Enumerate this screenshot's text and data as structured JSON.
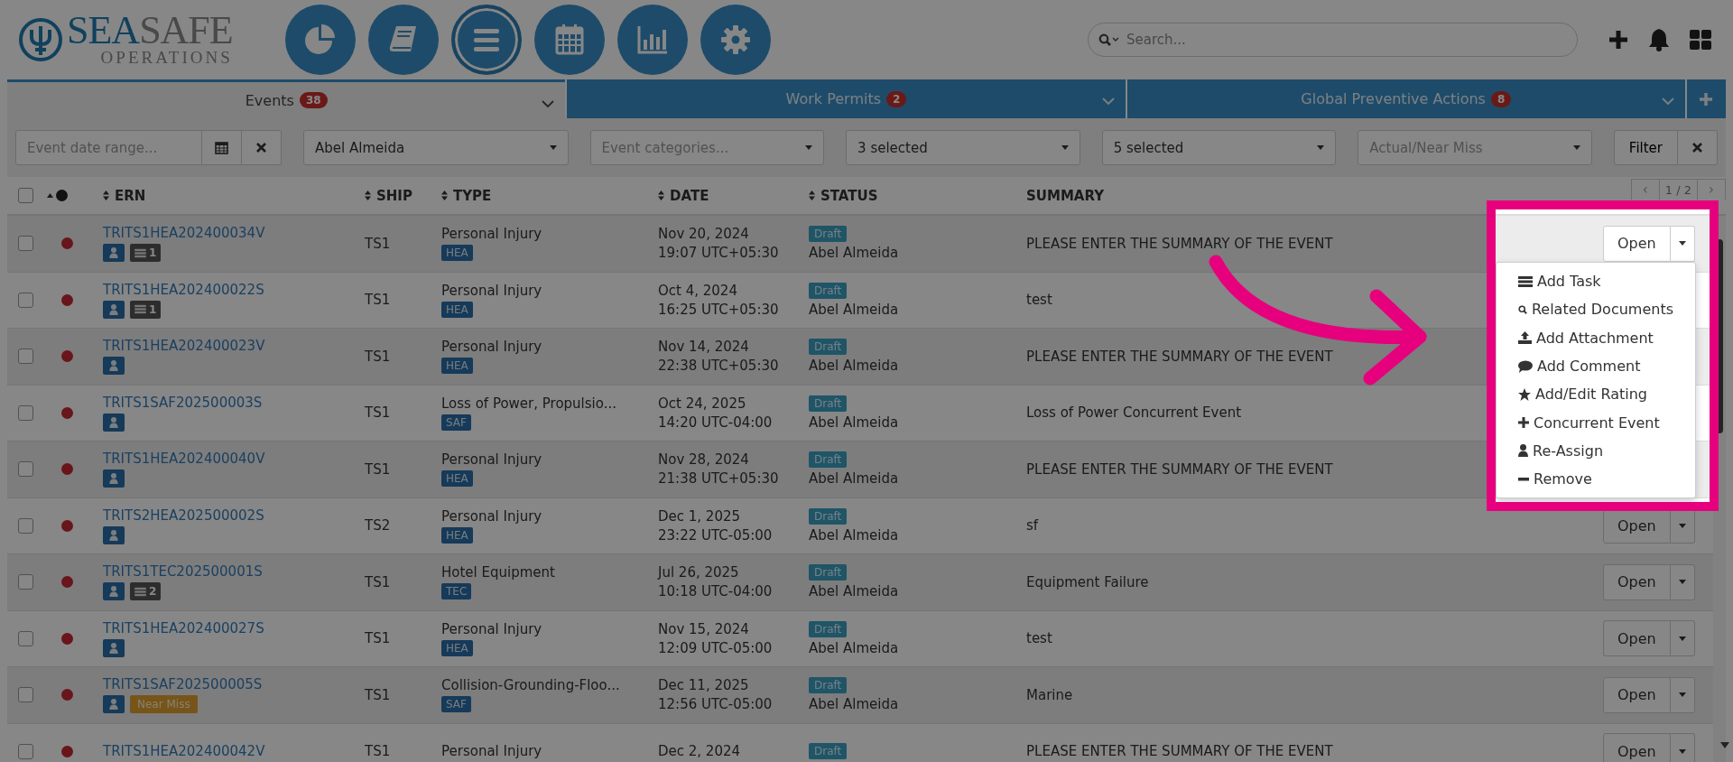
{
  "logo": {
    "primary": "SEA",
    "secondary": "SAFE",
    "tagline": "OPERATIONS"
  },
  "nav_buttons": [
    {
      "kind": "pie",
      "selected": false
    },
    {
      "kind": "book",
      "selected": false
    },
    {
      "kind": "list",
      "selected": true
    },
    {
      "kind": "calendar",
      "selected": false
    },
    {
      "kind": "chart",
      "selected": false
    },
    {
      "kind": "gear",
      "selected": false
    }
  ],
  "search": {
    "placeholder": "Search..."
  },
  "tabs": [
    {
      "label": "Events",
      "count": "38",
      "selected": true
    },
    {
      "label": "Work Permits",
      "count": "2",
      "selected": false
    },
    {
      "label": "Global Preventive Actions",
      "count": "8",
      "selected": false
    }
  ],
  "filters": {
    "date_range": {
      "placeholder": "Event date range..."
    },
    "selects": [
      {
        "value": "Abel Almeida"
      },
      {
        "placeholder": "Event categories..."
      },
      {
        "value": "3 selected"
      },
      {
        "value": "5 selected"
      },
      {
        "placeholder": "Actual/Near Miss"
      }
    ],
    "filter_button": "Filter"
  },
  "table": {
    "header_checked": false,
    "columns": [
      "ERN",
      "SHIP",
      "TYPE",
      "DATE",
      "STATUS",
      "SUMMARY"
    ],
    "pager": {
      "prev": "‹",
      "page": "1 / 2",
      "next": "›"
    },
    "rows": [
      {
        "checked": false,
        "ern": "TRITS1HEA202400034V",
        "comments": "1",
        "ship": "TS1",
        "type": "Personal Injury",
        "tag": "HEA",
        "date": "Nov 20, 2024",
        "time": "19:07 UTC+05:30",
        "status": "Draft",
        "assignee": "Abel Almeida",
        "summary": "PLEASE ENTER THE SUMMARY OF THE EVENT",
        "action": "Open"
      },
      {
        "checked": false,
        "ern": "TRITS1HEA202400022S",
        "comments": "1",
        "ship": "TS1",
        "type": "Personal Injury",
        "tag": "HEA",
        "date": "Oct 4, 2024",
        "time": "16:25 UTC+05:30",
        "status": "Draft",
        "assignee": "Abel Almeida",
        "summary": "test"
      },
      {
        "checked": false,
        "ern": "TRITS1HEA202400023V",
        "ship": "TS1",
        "type": "Personal Injury",
        "tag": "HEA",
        "date": "Nov 14, 2024",
        "time": "22:38 UTC+05:30",
        "status": "Draft",
        "assignee": "Abel Almeida",
        "summary": "PLEASE ENTER THE SUMMARY OF THE EVENT"
      },
      {
        "checked": false,
        "ern": "TRITS1SAF202500003S",
        "ship": "TS1",
        "type": "Loss of Power, Propulsio...",
        "tag": "SAF",
        "date": "Oct 24, 2025",
        "time": "14:20 UTC-04:00",
        "status": "Draft",
        "assignee": "Abel Almeida",
        "summary": "Loss of Power Concurrent Event"
      },
      {
        "checked": false,
        "ern": "TRITS1HEA202400040V",
        "ship": "TS1",
        "type": "Personal Injury",
        "tag": "HEA",
        "date": "Nov 28, 2024",
        "time": "21:38 UTC+05:30",
        "status": "Draft",
        "assignee": "Abel Almeida",
        "summary": "PLEASE ENTER THE SUMMARY OF THE EVENT"
      },
      {
        "checked": false,
        "ern": "TRITS2HEA202500002S",
        "ship": "TS2",
        "type": "Personal Injury",
        "tag": "HEA",
        "date": "Dec 1, 2025",
        "time": "23:22 UTC-05:00",
        "status": "Draft",
        "assignee": "Abel Almeida",
        "summary": "sf",
        "action": "Open"
      },
      {
        "checked": false,
        "ern": "TRITS1TEC202500001S",
        "comments": "2",
        "ship": "TS1",
        "type": "Hotel Equipment",
        "tag": "TEC",
        "date": "Jul 26, 2025",
        "time": "10:18 UTC-04:00",
        "status": "Draft",
        "assignee": "Abel Almeida",
        "summary": "Equipment Failure",
        "action": "Open"
      },
      {
        "checked": false,
        "ern": "TRITS1HEA202400027S",
        "ship": "TS1",
        "type": "Personal Injury",
        "tag": "HEA",
        "date": "Nov 15, 2024",
        "time": "12:09 UTC-05:00",
        "status": "Draft",
        "assignee": "Abel Almeida",
        "summary": "test",
        "action": "Open"
      },
      {
        "checked": false,
        "ern": "TRITS1SAF202500005S",
        "near_miss": "Near Miss",
        "ship": "TS1",
        "type": "Collision-Grounding-Floo...",
        "tag": "SAF",
        "date": "Dec 11, 2025",
        "time": "12:56 UTC-05:00",
        "status": "Draft",
        "assignee": "Abel Almeida",
        "summary": "Marine",
        "action": "Open"
      },
      {
        "checked": false,
        "ern": "TRITS1HEA202400042V",
        "ship": "TS1",
        "type": "Personal Injury",
        "date": "Dec 2, 2024",
        "status": "Draft",
        "summary": "PLEASE ENTER THE SUMMARY OF THE EVENT",
        "action": "Open"
      }
    ]
  },
  "menu": {
    "items": [
      {
        "kind": "task",
        "label": "Add Task"
      },
      {
        "kind": "search",
        "label": "Related Documents"
      },
      {
        "kind": "upload",
        "label": "Add Attachment"
      },
      {
        "kind": "comment",
        "label": "Add Comment"
      },
      {
        "kind": "star",
        "label": "Add/Edit Rating"
      },
      {
        "kind": "plus",
        "label": "Concurrent Event"
      },
      {
        "kind": "user",
        "label": "Re-Assign"
      },
      {
        "kind": "minus",
        "label": "Remove"
      }
    ]
  }
}
